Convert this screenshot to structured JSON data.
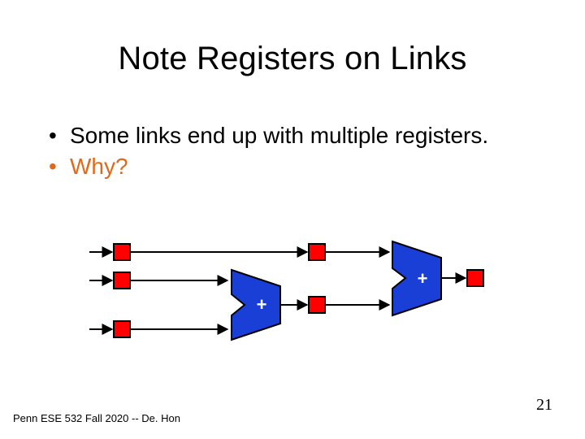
{
  "title": "Note Registers on Links",
  "bullets": {
    "b1": "Some links end up with multiple registers.",
    "b2": "Why?"
  },
  "footer": "Penn ESE 532 Fall 2020 -- De. Hon",
  "page_number": "21",
  "diagram": {
    "colors": {
      "register_fill": "#ff0000",
      "register_stroke": "#000000",
      "adder_fill": "#1a3fd6",
      "adder_symbol": "#ffffff",
      "wire": "#000000"
    }
  }
}
